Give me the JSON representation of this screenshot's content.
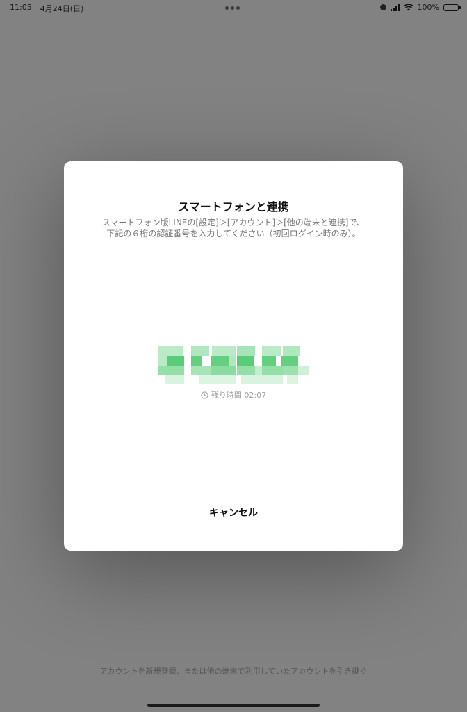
{
  "status_bar": {
    "time": "11:05",
    "date": "4月24日(日)",
    "battery": "100%"
  },
  "dialog": {
    "title": "スマートフォンと連携",
    "description": "スマートフォン版LINEの[設定]＞[アカウント]＞[他の端末と連携]で、下記の６桁の認証番号を入力してください（初回ログイン時のみ）。",
    "timer_label": "残り時間 02:07",
    "cancel_label": "キャンセル"
  },
  "background": {
    "bottom_link": "アカウントを新規登録、または他の端末で利用していたアカウントを引き継ぐ"
  },
  "icons": {
    "timer": "clock-icon",
    "status": [
      "moon-icon",
      "cellular-signal-icon",
      "wifi-icon",
      "battery-icon"
    ]
  },
  "colors": {
    "overlay": "#828282",
    "dialog_bg": "#ffffff",
    "code_green": "#3cc35f",
    "muted_text": "#777777"
  }
}
